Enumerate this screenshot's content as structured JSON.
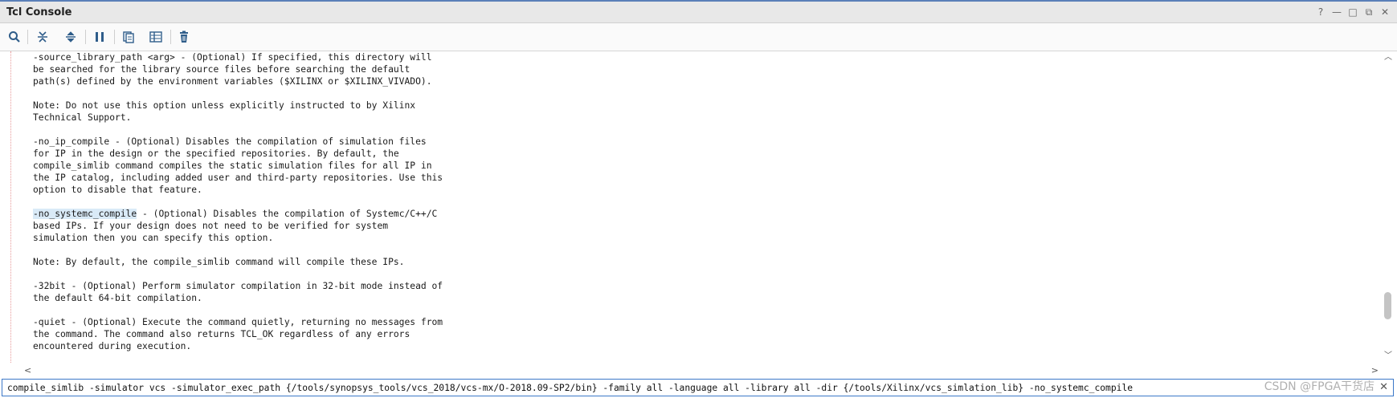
{
  "window": {
    "title": "Tcl Console",
    "controls": [
      "?",
      "—",
      "□",
      "⧉",
      "✕"
    ]
  },
  "toolbar": {
    "icons": [
      "search-icon",
      "collapse-all-icon",
      "expand-all-icon",
      "pause-icon",
      "copy-icon",
      "columns-icon",
      "trash-icon"
    ]
  },
  "console": {
    "lines": [
      {
        "text": "-source_library_path <arg> - (Optional) If specified, this directory will"
      },
      {
        "text": "be searched for the library source files before searching the default"
      },
      {
        "text": "path(s) defined by the environment variables ($XILINX or $XILINX_VIVADO)."
      },
      {
        "text": ""
      },
      {
        "text": "Note: Do not use this option unless explicitly instructed to by Xilinx"
      },
      {
        "text": "Technical Support."
      },
      {
        "text": ""
      },
      {
        "text": "-no_ip_compile - (Optional) Disables the compilation of simulation files"
      },
      {
        "text": "for IP in the design or the specified repositories. By default, the"
      },
      {
        "text": "compile_simlib command compiles the static simulation files for all IP in"
      },
      {
        "text": "the IP catalog, including added user and third-party repositories. Use this"
      },
      {
        "text": "option to disable that feature."
      },
      {
        "text": ""
      },
      {
        "highlight": "-no_systemc_compile",
        "text": " - (Optional) Disables the compilation of Systemc/C++/C"
      },
      {
        "text": "based IPs. If your design does not need to be verified for system"
      },
      {
        "text": "simulation then you can specify this option."
      },
      {
        "text": ""
      },
      {
        "text": "Note: By default, the compile_simlib command will compile these IPs."
      },
      {
        "text": ""
      },
      {
        "text": "-32bit - (Optional) Perform simulator compilation in 32-bit mode instead of"
      },
      {
        "text": "the default 64-bit compilation."
      },
      {
        "text": ""
      },
      {
        "text": "-quiet - (Optional) Execute the command quietly, returning no messages from"
      },
      {
        "text": "the command. The command also returns TCL_OK regardless of any errors"
      },
      {
        "text": "encountered during execution."
      }
    ]
  },
  "command_input": {
    "value": "compile_simlib -simulator vcs -simulator_exec_path {/tools/synopsys_tools/vcs_2018/vcs-mx/O-2018.09-SP2/bin} -family all -language all -library all -dir {/tools/Xilinx/vcs_simlation_lib} -no_systemc_compile"
  },
  "watermark": "CSDN @FPGA干货店"
}
